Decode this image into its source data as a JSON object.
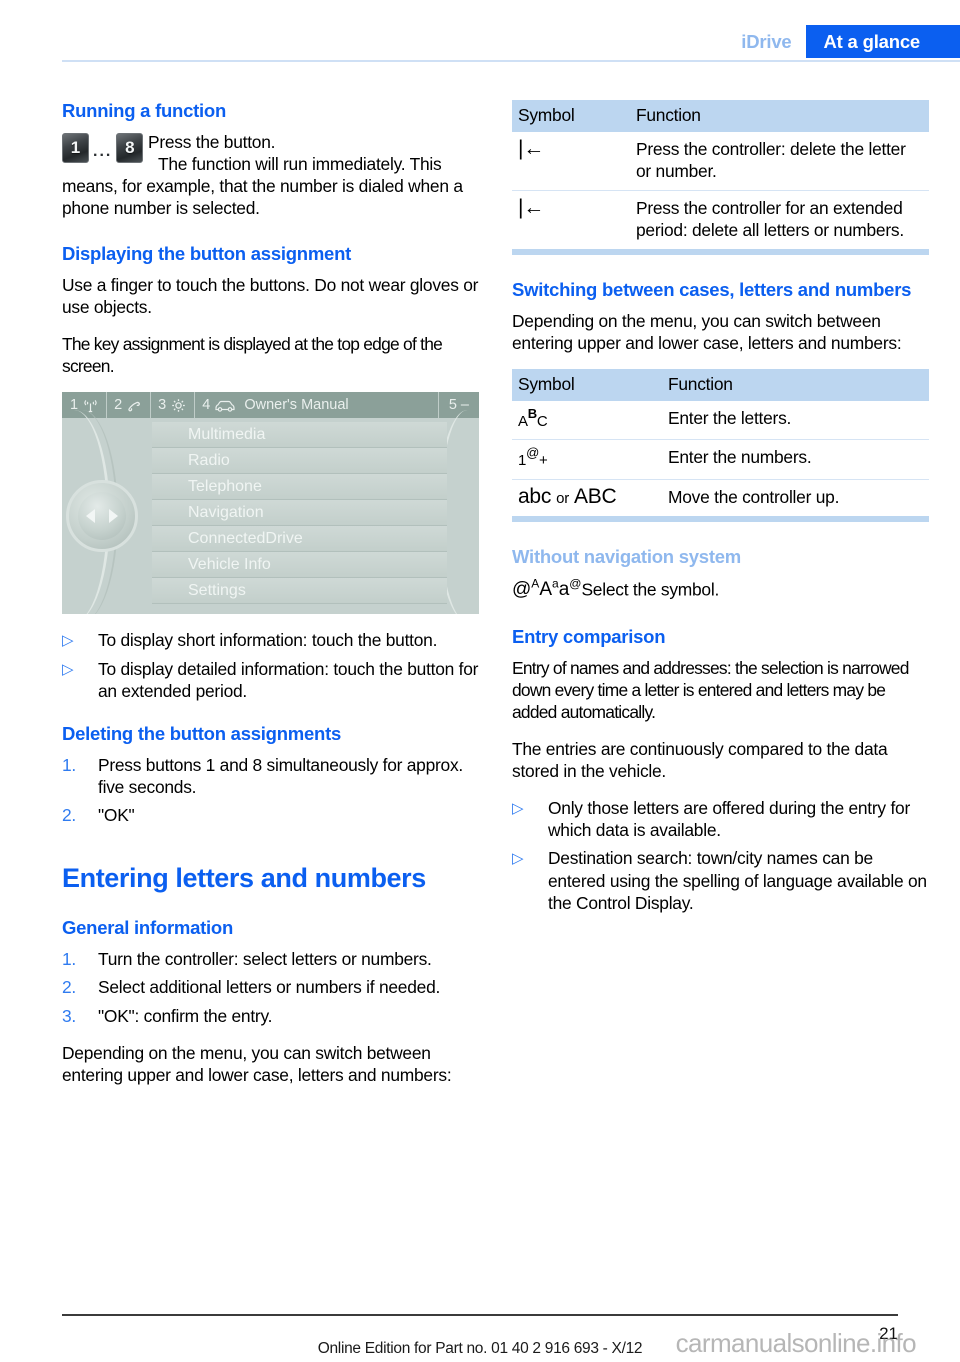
{
  "header": {
    "chapter": "iDrive",
    "section": "At a glance"
  },
  "left": {
    "h_running": "Running a function",
    "keys": {
      "first": "1",
      "dots": "...",
      "last": "8"
    },
    "press_line1": "Press the button.",
    "press_line2": "The function will run immediately. This",
    "press_cont": "means, for example, that the number is dialed when a phone number is selected.",
    "h_displaying": "Displaying the button assignment",
    "p_displaying_1": "Use a finger to touch the buttons. Do not wear gloves or use objects.",
    "p_displaying_2": "The key assignment is displayed at the top edge of the screen.",
    "idrive": {
      "tabs": [
        {
          "num": "1",
          "icon": "antenna-icon"
        },
        {
          "num": "2",
          "icon": "telephone-icon"
        },
        {
          "num": "3",
          "icon": "gear-icon"
        },
        {
          "num": "4",
          "icon": "car-icon"
        }
      ],
      "title": "Owner's Manual",
      "last": "5 –",
      "menu": [
        "Multimedia",
        "Radio",
        "Telephone",
        "Navigation",
        "ConnectedDrive",
        "Vehicle Info",
        "Settings"
      ]
    },
    "bullets": [
      "To display short information: touch the but-ton.",
      "To display detailed information: touch the button for an extended period."
    ],
    "bullets_display": [
      "To display short information: touch the button.",
      "To display detailed information: touch the button for an extended period."
    ],
    "h_deleting": "Deleting the button assignments",
    "deleting_steps": [
      {
        "n": "1.",
        "text": "Press buttons 1 and 8 simultaneously for approx. five seconds."
      },
      {
        "n": "2.",
        "text": "\"OK\""
      }
    ],
    "h_entering": "Entering letters and numbers",
    "h_general": "General information",
    "general_steps": [
      {
        "n": "1.",
        "text": "Turn the controller: select letters or numbers."
      },
      {
        "n": "2.",
        "text": "Select additional letters or numbers if needed."
      },
      {
        "n": "3.",
        "text": "\"OK\": confirm the entry."
      }
    ],
    "p_depending": "Depending on the menu, you can switch between entering upper and lower case, letters and numbers:"
  },
  "right": {
    "table1": {
      "columns": [
        "Symbol",
        "Function"
      ],
      "rows": [
        {
          "symbol": "|←",
          "symbol_name": "backspace-icon",
          "function": "Press the controller: delete the letter or number."
        },
        {
          "symbol": "|←",
          "symbol_name": "backspace-long-icon",
          "function": "Press the controller for an extended period: delete all letters or numbers."
        }
      ]
    },
    "h_switching": "Switching between cases, letters and numbers",
    "p_switching": "Depending on the menu, you can switch between entering upper and lower case, letters and numbers:",
    "table2": {
      "columns": [
        "Symbol",
        "Function"
      ],
      "rows": [
        {
          "symbol": "AᴮC",
          "symbol_name": "letters-abc-icon",
          "function": "Enter the letters."
        },
        {
          "symbol": "1@+",
          "symbol_name": "numbers-icon",
          "function": "Enter the numbers."
        },
        {
          "symbol": "abc or ABC",
          "symbol_name": "case-toggle-icon",
          "function": "Move the controller up."
        }
      ]
    },
    "h_without_nav": "Without navigation system",
    "without_nav_symbols": [
      "@ᴀ",
      "Aᵃ",
      "a@"
    ],
    "without_nav_text": "Select the symbol.",
    "h_entry_comparison": "Entry comparison",
    "p_entry_1": "Entry of names and addresses: the selection is narrowed down every time a letter is entered and letters may be added automatically.",
    "p_entry_2": "The entries are continuously compared to the data stored in the vehicle.",
    "bullets": [
      "Only those letters are offered during the entry for which data is available.",
      "Destination search: town/city names can be entered using the spelling of language available on the Control Display."
    ]
  },
  "footer": {
    "edition": "Online Edition for Part no. 01 40 2 916 693 - X/12",
    "page": "21",
    "watermark": "carmanualsonline.info"
  }
}
